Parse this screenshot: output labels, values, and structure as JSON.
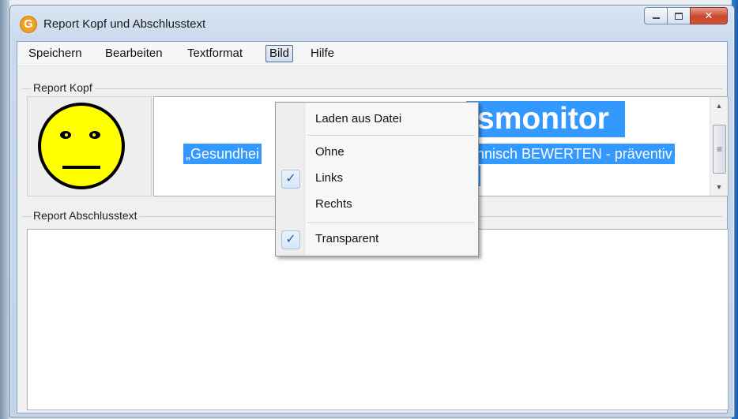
{
  "window": {
    "title": "Report Kopf und Abschlusstext",
    "app_icon": "G",
    "controls": {
      "minimize": "minimize-icon",
      "maximize": "maximize-icon",
      "close": "close-icon"
    }
  },
  "menu": {
    "items": [
      "Speichern",
      "Bearbeiten",
      "Textformat",
      "Bild",
      "Hilfe"
    ],
    "active": "Bild"
  },
  "report_kopf": {
    "label": "Report Kopf",
    "image": "neutral-smiley-face",
    "headline_visible": "smonitor",
    "line2_left": "„Gesundhei",
    "line2_right": "ännisch BEWERTEN - präventiv",
    "line3": "\""
  },
  "report_abschluss": {
    "label": "Report Abschlusstext",
    "text": ""
  },
  "bild_menu": {
    "items": [
      {
        "label": "Laden aus Datei",
        "checked": false
      },
      {
        "label": "Ohne",
        "checked": false
      },
      {
        "label": "Links",
        "checked": true
      },
      {
        "label": "Rechts",
        "checked": false
      },
      {
        "label": "Transparent",
        "checked": true
      }
    ],
    "check_glyph": "✓"
  },
  "colors": {
    "selection": "#3399ff",
    "smiley_fill": "#ffff00",
    "close_button": "#c8462c"
  }
}
